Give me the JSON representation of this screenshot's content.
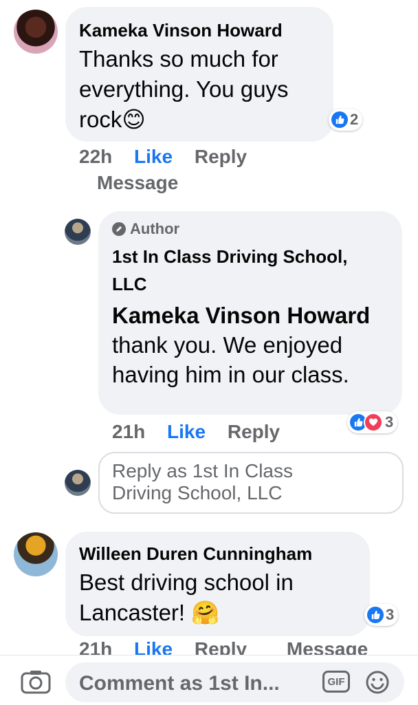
{
  "comments": [
    {
      "author": "Kameka Vinson Howard",
      "text": "Thanks so much for everything. You guys rock",
      "emoji": "😊",
      "reaction_count": "2",
      "time": "22h",
      "like_label": "Like",
      "reply_label": "Reply",
      "message_label": "Message"
    },
    {
      "badge": "Author",
      "author": "1st In Class Driving School, LLC",
      "mention": "Kameka Vinson Howard",
      "text": " thank you. We enjoyed having him in our class.",
      "reaction_count": "3",
      "time": "21h",
      "like_label": "Like",
      "reply_label": "Reply"
    },
    {
      "author": "Willeen Duren Cunningham",
      "text": "Best driving school in Lancaster!",
      "emoji": "🤗",
      "reaction_count": "3",
      "time": "21h",
      "like_label": "Like",
      "reply_label": "Reply",
      "message_label": "Message"
    }
  ],
  "reply_box": {
    "placeholder": "Reply as 1st In Class Driving School, LLC"
  },
  "composer": {
    "placeholder": "Comment as 1st In...",
    "gif_label": "GIF",
    "camera_icon": "camera-icon",
    "emoji_icon": "smiley-icon"
  },
  "colors": {
    "accent": "#1877f2",
    "bubble": "#f0f2f5",
    "muted": "#65676b",
    "love": "#f33e58"
  }
}
